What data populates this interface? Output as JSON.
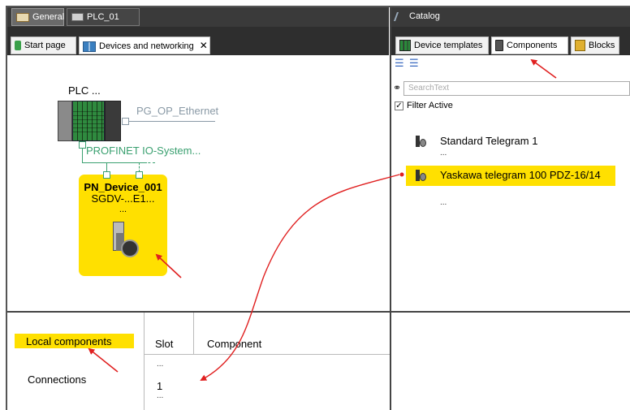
{
  "top_tabs": [
    {
      "label": "General",
      "icon": "house-icon"
    },
    {
      "label": "PLC_01",
      "icon": "plc-icon"
    }
  ],
  "editor_tabs": [
    {
      "label": "Start page",
      "icon": "start-icon"
    },
    {
      "label": "Devices and networking",
      "icon": "network-icon",
      "close": "✕"
    }
  ],
  "catalog": {
    "title": "Catalog",
    "tabs": [
      {
        "label": "Device templates",
        "icon": "device-templates-icon"
      },
      {
        "label": "Components",
        "icon": "components-icon"
      },
      {
        "label": "Blocks",
        "icon": "blocks-icon"
      }
    ],
    "search_placeholder": "SearchText",
    "filter_label": "Filter Active",
    "filter_checked": true,
    "items": [
      {
        "label": "Standard Telegram 1",
        "sub": "..."
      },
      {
        "label": "Yaskawa telegram 100 PDZ-16/14",
        "highlight": "#ffe000"
      }
    ],
    "trailing_dots": "..."
  },
  "diagram": {
    "plc_label": "PLC ...",
    "ethernet_label": "PG_OP_Ethernet",
    "profinet_label": "PROFINET IO-System...",
    "device": {
      "name": "PN_Device_001",
      "type": "SGDV-...E1...",
      "dots": "...",
      "color": "#ffe000"
    }
  },
  "bottom": {
    "nav": [
      {
        "label": "Local components",
        "highlight": "#ffe000"
      },
      {
        "label": "Connections"
      }
    ],
    "table": {
      "headers": [
        "Slot",
        "Component"
      ],
      "rows": [
        "...",
        "1",
        "..."
      ]
    }
  },
  "colors": {
    "accent_yellow": "#ffe000",
    "arrow_red": "#e02020",
    "profinet_green": "#3aa070",
    "ethernet_gray": "#8a9aa6"
  }
}
